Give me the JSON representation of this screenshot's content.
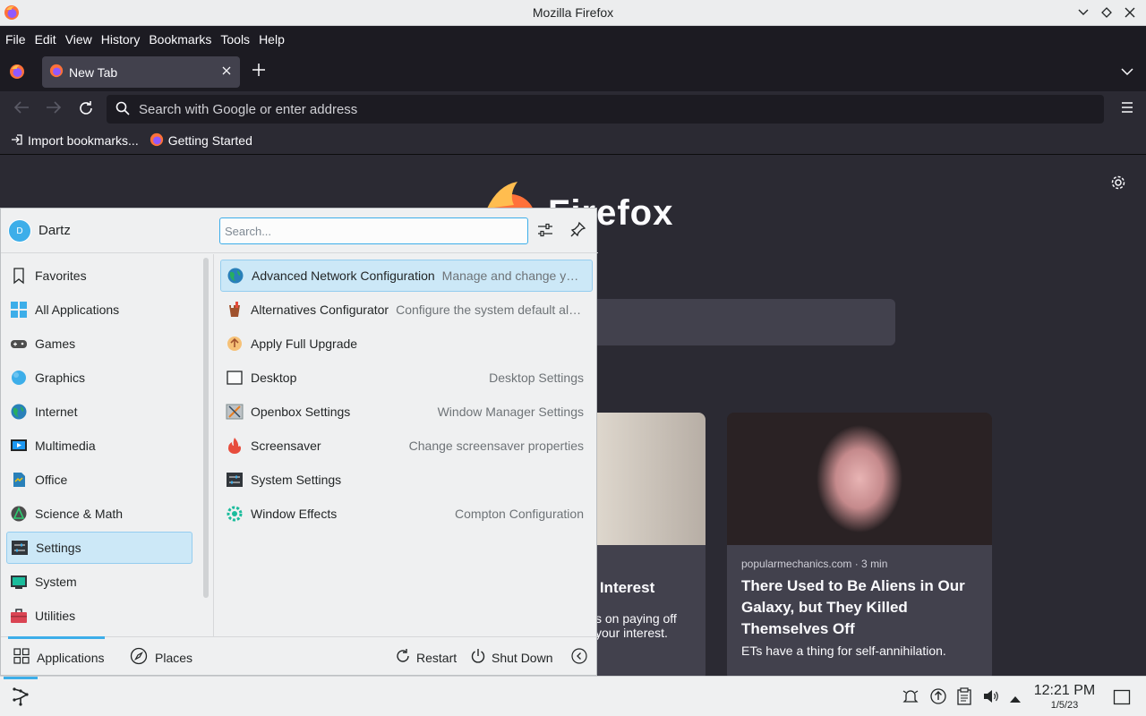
{
  "window": {
    "title": "Mozilla Firefox"
  },
  "menubar": {
    "file": "File",
    "edit": "Edit",
    "view": "View",
    "history": "History",
    "bookmarks": "Bookmarks",
    "tools": "Tools",
    "help": "Help"
  },
  "tabs": [
    {
      "label": "New Tab"
    }
  ],
  "urlbar": {
    "placeholder": "Search with Google or enter address"
  },
  "bookmarks": {
    "import": "Import bookmarks...",
    "getting_started": "Getting Started"
  },
  "newtab": {
    "logo_word": "Firefox",
    "cards": [
      {
        "headline": "% Interest",
        "excerpt": "s on paying off your interest."
      },
      {
        "source": "popularmechanics.com · 3 min",
        "headline": "There Used to Be Aliens in Our Galaxy, but They Killed Themselves Off",
        "excerpt": "ETs have a thing for self-annihilation."
      }
    ]
  },
  "launcher": {
    "user": "Dartz",
    "avatar_letter": "D",
    "search_placeholder": "Search...",
    "categories": [
      {
        "label": "Favorites",
        "icon": "bookmark-icon"
      },
      {
        "label": "All Applications",
        "icon": "grid-icon"
      },
      {
        "label": "Games",
        "icon": "gamepad-icon"
      },
      {
        "label": "Graphics",
        "icon": "graphics-icon"
      },
      {
        "label": "Internet",
        "icon": "globe-icon"
      },
      {
        "label": "Multimedia",
        "icon": "multimedia-icon"
      },
      {
        "label": "Office",
        "icon": "office-icon"
      },
      {
        "label": "Science & Math",
        "icon": "science-icon"
      },
      {
        "label": "Settings",
        "icon": "settings-icon"
      },
      {
        "label": "System",
        "icon": "system-icon"
      },
      {
        "label": "Utilities",
        "icon": "toolbox-icon"
      }
    ],
    "selected_category": "Settings",
    "apps": [
      {
        "name": "Advanced Network Configuration",
        "desc": "Manage and change your network connection settings"
      },
      {
        "name": "Alternatives Configurator",
        "desc": "Configure the system default alternatives"
      },
      {
        "name": "Apply Full Upgrade",
        "desc": ""
      },
      {
        "name": "Desktop",
        "desc": "Desktop Settings"
      },
      {
        "name": "Openbox Settings",
        "desc": "Window Manager Settings"
      },
      {
        "name": "Screensaver",
        "desc": "Change screensaver properties"
      },
      {
        "name": "System Settings",
        "desc": ""
      },
      {
        "name": "Window Effects",
        "desc": "Compton Configuration"
      }
    ],
    "footer": {
      "applications": "Applications",
      "places": "Places",
      "restart": "Restart",
      "shutdown": "Shut Down"
    }
  },
  "taskbar": {
    "time": "12:21 PM",
    "date": "1/5/23"
  },
  "colors": {
    "accent": "#3daee9",
    "browser_bg": "#2b2a33",
    "panel_bg": "#eff0f1"
  }
}
